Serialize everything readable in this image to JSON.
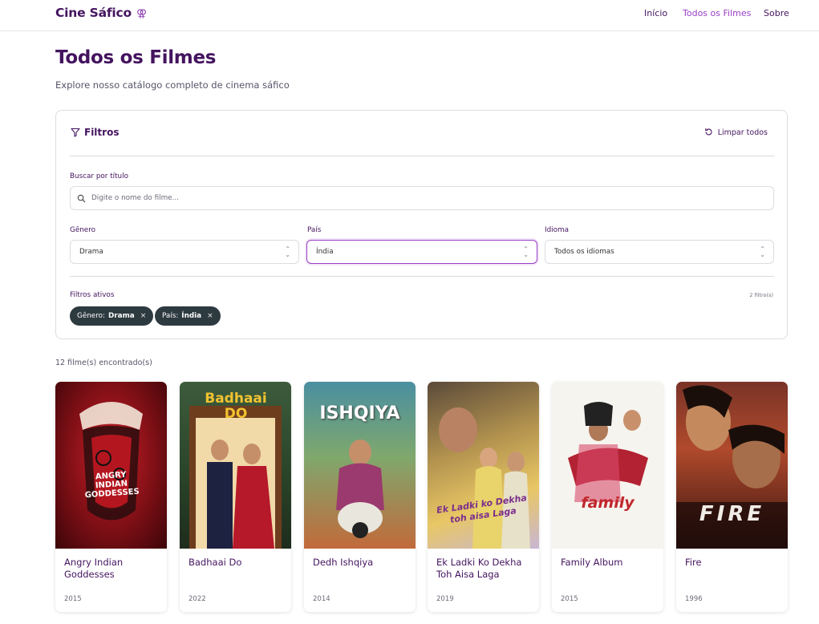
{
  "nav": {
    "brand": "Cine Sáfico",
    "brand_icon": "⚢",
    "links": [
      {
        "label": "Início",
        "active": false
      },
      {
        "label": "Todos os Filmes",
        "active": true
      },
      {
        "label": "Sobre",
        "active": false
      }
    ]
  },
  "header": {
    "title": "Todos os Filmes",
    "subtitle": "Explore nosso catálogo completo de cinema sáfico"
  },
  "filters": {
    "title": "Filtros",
    "clear_label": "Limpar todos",
    "search": {
      "label": "Buscar por título",
      "placeholder": "Digite o nome do filme...",
      "value": ""
    },
    "genre": {
      "label": "Gênero",
      "value": "Drama"
    },
    "country": {
      "label": "País",
      "value": "Índia"
    },
    "language": {
      "label": "Idioma",
      "value": "Todos os idiomas"
    },
    "active_label": "Filtros ativos",
    "active_count": "2 filtro(s)",
    "chips": [
      {
        "key": "Gênero:",
        "value": "Drama",
        "remove": "×"
      },
      {
        "key": "País:",
        "value": "Índia",
        "remove": "×"
      }
    ]
  },
  "results_count": "12 filme(s) encontrado(s)",
  "movies": [
    {
      "title": "Angry Indian Goddesses",
      "year": "2015",
      "poster_text": "ANGRY INDIAN GODDESSES"
    },
    {
      "title": "Badhaai Do",
      "year": "2022",
      "poster_text": "Badhaai DO"
    },
    {
      "title": "Dedh Ishqiya",
      "year": "2014",
      "poster_text": "ISHQIYA"
    },
    {
      "title": "Ek Ladki Ko Dekha Toh Aisa Laga",
      "year": "2019",
      "poster_text": "Ek Ladki ko Dekha toh aisa Laga"
    },
    {
      "title": "Family Album",
      "year": "2015",
      "poster_text": "family"
    },
    {
      "title": "Fire",
      "year": "1996",
      "poster_text": "FIRE"
    }
  ]
}
